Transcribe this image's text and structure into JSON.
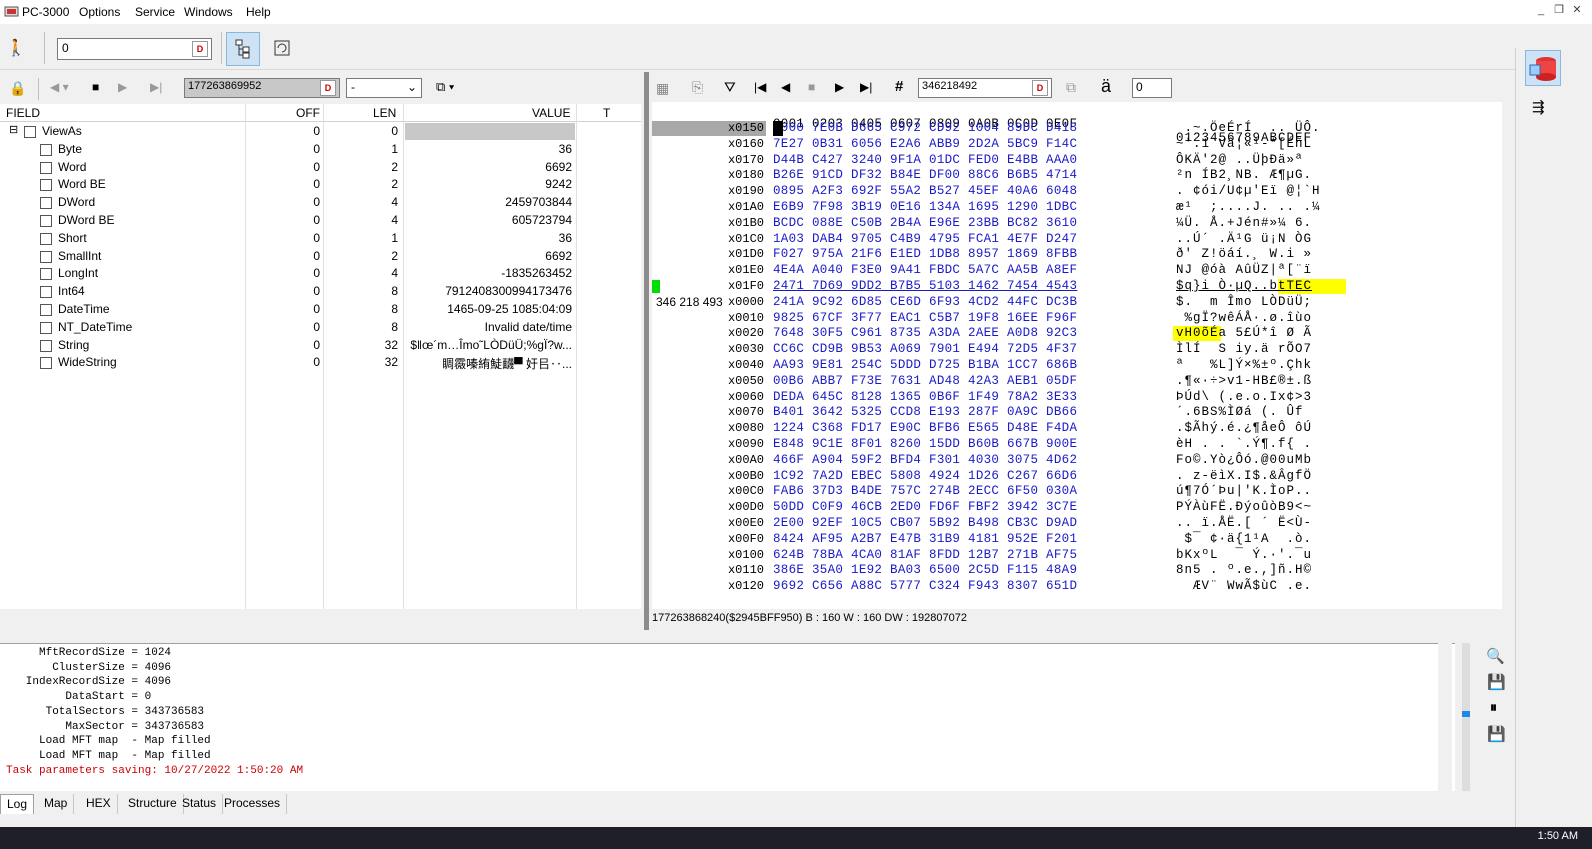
{
  "app": {
    "title": "PC-3000",
    "menu": [
      "Options",
      "Service",
      "Windows",
      "Help"
    ]
  },
  "toolbar": {
    "value_input": "0",
    "d_button": "D"
  },
  "left_toolbar": {
    "address_input": "177263869952",
    "dropdown_value": "-"
  },
  "fields": {
    "headers": {
      "field": "FIELD",
      "off": "OFF",
      "len": "LEN",
      "value": "VALUE",
      "t": "T"
    },
    "rows": [
      {
        "name": "ViewAs",
        "off": "0",
        "len": "0",
        "value": "",
        "indent": 0,
        "expander": "⊟"
      },
      {
        "name": "Byte",
        "off": "0",
        "len": "1",
        "value": "36",
        "indent": 1
      },
      {
        "name": "Word",
        "off": "0",
        "len": "2",
        "value": "6692",
        "indent": 1
      },
      {
        "name": "Word BE",
        "off": "0",
        "len": "2",
        "value": "9242",
        "indent": 1
      },
      {
        "name": "DWord",
        "off": "0",
        "len": "4",
        "value": "2459703844",
        "indent": 1
      },
      {
        "name": "DWord BE",
        "off": "0",
        "len": "4",
        "value": "605723794",
        "indent": 1
      },
      {
        "name": "Short",
        "off": "0",
        "len": "1",
        "value": "36",
        "indent": 1
      },
      {
        "name": "SmallInt",
        "off": "0",
        "len": "2",
        "value": "6692",
        "indent": 1
      },
      {
        "name": "LongInt",
        "off": "0",
        "len": "4",
        "value": "-1835263452",
        "indent": 1
      },
      {
        "name": "Int64",
        "off": "0",
        "len": "8",
        "value": "7912408300994173476",
        "indent": 1
      },
      {
        "name": "DateTime",
        "off": "0",
        "len": "8",
        "value": "1465-09-25 1085:04:09",
        "indent": 1
      },
      {
        "name": "NT_DateTime",
        "off": "0",
        "len": "8",
        "value": "Invalid date/time",
        "indent": 1
      },
      {
        "name": "String",
        "off": "0",
        "len": "32",
        "value": "$‖œ´m…Îmo˜LÒDüÜ;%gÏ?w...",
        "indent": 1
      },
      {
        "name": "WideString",
        "off": "0",
        "len": "32",
        "value": "睭霺嗪絠鯐䩏▀ 㚥㠯‥...",
        "indent": 1
      }
    ]
  },
  "hex_toolbar": {
    "sector_input": "346218492",
    "spin_value": "0",
    "char_glyph": "ä"
  },
  "hex": {
    "header_cols": "0001 0203 0405 0607 0809 0A0B 0C0D 0E0F",
    "header_ascii": "0123456789ABCDEF",
    "sector_label": "346 218 493",
    "rows": [
      {
        "addr": "x0150",
        "data": "A000 7E0B D665 C972 CD92 1004 89DC D418",
        "ascii": " .~.ÖeÉrÍ  .. ÜÔ."
      },
      {
        "addr": "x0160",
        "data": "7E27 0B31 6056 E2A6 ABB9 2D2A 5BC9 F14C",
        "ascii": "~'.1`Vâ¦«¹-*[ÉñL"
      },
      {
        "addr": "x0170",
        "data": "D44B C427 3240 9F1A 01DC FED0 E4BB AAA0",
        "ascii": "ÔKÄ'2@ ..ÜþÐä»ª "
      },
      {
        "addr": "x0180",
        "data": "B26E 91CD DF32 B84E DF00 88C6 B6B5 4714",
        "ascii": "²n ÍB2¸NB. Æ¶µG."
      },
      {
        "addr": "x0190",
        "data": "0895 A2F3 692F 55A2 B527 45EF 40A6 6048",
        "ascii": ". ¢ói/U¢µ'Eï @¦`H"
      },
      {
        "addr": "x01A0",
        "data": "E6B9 7F98 3B19 0E16 134A 1695 1290 1DBC",
        "ascii": "æ¹  ;....J. .. .¼"
      },
      {
        "addr": "x01B0",
        "data": "BCDC 088E C50B 2B4A E96E 23BB BC82 3610",
        "ascii": "¼Ü. Å.+Jén#»¼ 6."
      },
      {
        "addr": "x01C0",
        "data": "1A03 DAB4 9705 C4B9 4795 FCA1 4E7F D247",
        "ascii": "..Ú´ .Ä¹G ü¡N ÒG"
      },
      {
        "addr": "x01D0",
        "data": "F027 975A 21F6 E1ED 1DB8 8957 1869 8FBB",
        "ascii": "ð' Z!öáí.¸ W.i »"
      },
      {
        "addr": "x01E0",
        "data": "4E4A A040 F3E0 9A41 FBDC 5A7C AA5B A8EF",
        "ascii": "NJ @óà AûÜZ|ª[¨ï"
      },
      {
        "addr": "x01F0",
        "data": "2471 7D69 9DD2 B7B5 5103 1462 7454 4543",
        "ascii": "$q}i Ò·µQ..btTEC",
        "underline": true
      },
      {
        "addr": "x0000",
        "data": "241A 9C92 6D85 CE6D 6F93 4CD2 44FC DC3B",
        "ascii": "$.  m Îmo LÒDüÜ;",
        "sector": true
      },
      {
        "addr": "x0010",
        "data": "9825 67CF 3F77 EAC1 C5B7 19F8 16EE F96F",
        "ascii": " %gÏ?wêÁÅ·.ø.îùo"
      },
      {
        "addr": "x0020",
        "data": "7648 30F5 C961 8735 A3DA 2AEE A0D8 92C3",
        "ascii": "vH0õÉa 5£Ú*î Ø Ã"
      },
      {
        "addr": "x0030",
        "data": "CC6C CD9B 9B53 A069 7901 E494 72D5 4F37",
        "ascii": "ÌlÍ  S iy.ä rÕO7"
      },
      {
        "addr": "x0040",
        "data": "AA93 9E81 254C 5DDD D725 B1BA 1CC7 686B",
        "ascii": "ª   %L]Ý×%±º.Çhk"
      },
      {
        "addr": "x0050",
        "data": "00B6 ABB7 F73E 7631 AD48 42A3 AEB1 05DF",
        "ascii": ".¶«·÷>v1-HB£®±.ß"
      },
      {
        "addr": "x0060",
        "data": "DEDA 645C 8128 1365 0B6F 1F49 78A2 3E33",
        "ascii": "ÞÚd\\ (.e.o.Ix¢>3"
      },
      {
        "addr": "x0070",
        "data": "B401 3642 5325 CCD8 E193 287F 0A9C DB66",
        "ascii": "´.6BS%ÌØá (. Ûf"
      },
      {
        "addr": "x0080",
        "data": "1224 C368 FD17 E90C BFB6 E565 D48E F4DA",
        "ascii": ".$Ãhý.é.¿¶åeÔ ôÚ"
      },
      {
        "addr": "x0090",
        "data": "E848 9C1E 8F01 8260 15DD B60B 667B 900E",
        "ascii": "èH . . `.Ý¶.f{ ."
      },
      {
        "addr": "x00A0",
        "data": "466F A904 59F2 BFD4 F301 4030 3075 4D62",
        "ascii": "Fo©.Yò¿Ôó.@00uMb"
      },
      {
        "addr": "x00B0",
        "data": "1C92 7A2D EBEC 5808 4924 1D26 C267 66D6",
        "ascii": ". z-ëìX.I$.&ÂgfÖ"
      },
      {
        "addr": "x00C0",
        "data": "FAB6 37D3 B4DE 757C 274B 2ECC 6F50 030A",
        "ascii": "ú¶7Ó´Þu|'K.ÌoP.."
      },
      {
        "addr": "x00D0",
        "data": "50DD C0F9 46CB 2ED0 FD6F FBF2 3942 3C7E",
        "ascii": "PÝÀùFË.ÐýoûòB9<~"
      },
      {
        "addr": "x00E0",
        "data": "2E00 92EF 10C5 CB07 5B92 B498 CB3C D9AD",
        "ascii": ".. ï.ÅË.[ ´ Ë<Ù-"
      },
      {
        "addr": "x00F0",
        "data": "8424 AF95 A2B7 E47B 31B9 4181 952E F201",
        "ascii": " $¯ ¢·ä{1¹A  .ò."
      },
      {
        "addr": "x0100",
        "data": "624B 78BA 4CA0 81AF 8FDD 12B7 271B AF75",
        "ascii": "bKxºL  ¯ Ý.·'.¯u"
      },
      {
        "addr": "x0110",
        "data": "386E 35A0 1E92 BA03 6500 2C5D F115 48A9",
        "ascii": "8n5 . º.e.,]ñ.H©"
      },
      {
        "addr": "x0120",
        "data": "9692 C656 A88C 5777 C324 F943 8307 651D",
        "ascii": "  ÆV¨ WwÃ$ùC .e."
      }
    ]
  },
  "hex_status": "177263868240($2945BFF950) B : 160 W : 160 DW : 192807072",
  "log": {
    "lines": [
      {
        "text": "     MftRecordSize = 1024",
        "color": "#000000"
      },
      {
        "text": "       ClusterSize = 4096",
        "color": "#000000"
      },
      {
        "text": "   IndexRecordSize = 4096",
        "color": "#000000"
      },
      {
        "text": "         DataStart = 0",
        "color": "#000000"
      },
      {
        "text": "      TotalSectors = 343736583",
        "color": "#000000"
      },
      {
        "text": "         MaxSector = 343736583",
        "color": "#000000"
      },
      {
        "text": "     Load MFT map  - Map filled",
        "color": "#000000"
      },
      {
        "text": "     Load MFT map  - Map filled",
        "color": "#000000"
      },
      {
        "text": "Task parameters saving: 10/27/2022 1:50:20 AM",
        "color": "#cc0000"
      }
    ]
  },
  "tabs": [
    "Log",
    "Map",
    "HEX",
    "Structure",
    "Status",
    "Processes"
  ],
  "taskbar": {
    "clock": "1:50 AM"
  },
  "colors": {
    "highlight": "#ffff00",
    "hex_blue": "#1a1ac8",
    "sector_green": "#00dd00"
  }
}
